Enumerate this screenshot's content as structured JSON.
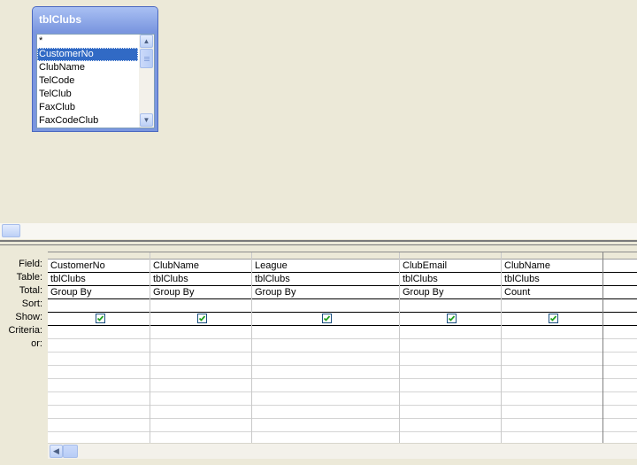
{
  "table_window": {
    "title": "tblClubs",
    "fields": [
      "*",
      "CustomerNo",
      "ClubName",
      "TelCode",
      "TelClub",
      "FaxClub",
      "FaxCodeClub"
    ],
    "selected_field": "CustomerNo"
  },
  "grid": {
    "row_labels": {
      "field": "Field:",
      "table": "Table:",
      "total": "Total:",
      "sort": "Sort:",
      "show": "Show:",
      "criteria": "Criteria:",
      "or": "or:"
    },
    "columns": [
      {
        "field": "CustomerNo",
        "table": "tblClubs",
        "total": "Group By",
        "sort": "",
        "show": true
      },
      {
        "field": "ClubName",
        "table": "tblClubs",
        "total": "Group By",
        "sort": "",
        "show": true
      },
      {
        "field": "League",
        "table": "tblClubs",
        "total": "Group By",
        "sort": "",
        "show": true
      },
      {
        "field": "ClubEmail",
        "table": "tblClubs",
        "total": "Group By",
        "sort": "",
        "show": true
      },
      {
        "field": "ClubName",
        "table": "tblClubs",
        "total": "Count",
        "sort": "",
        "show": true
      }
    ]
  },
  "icons": {
    "scroll_up": "scroll-up-arrow-icon",
    "scroll_down": "scroll-down-arrow-icon",
    "scroll_left": "scroll-left-arrow-icon",
    "checkbox": "checkbox-checked-icon"
  },
  "colors": {
    "background": "#ece9d8",
    "window_blue": "#7a96df",
    "selection": "#316ac5",
    "check": "#21a121"
  }
}
